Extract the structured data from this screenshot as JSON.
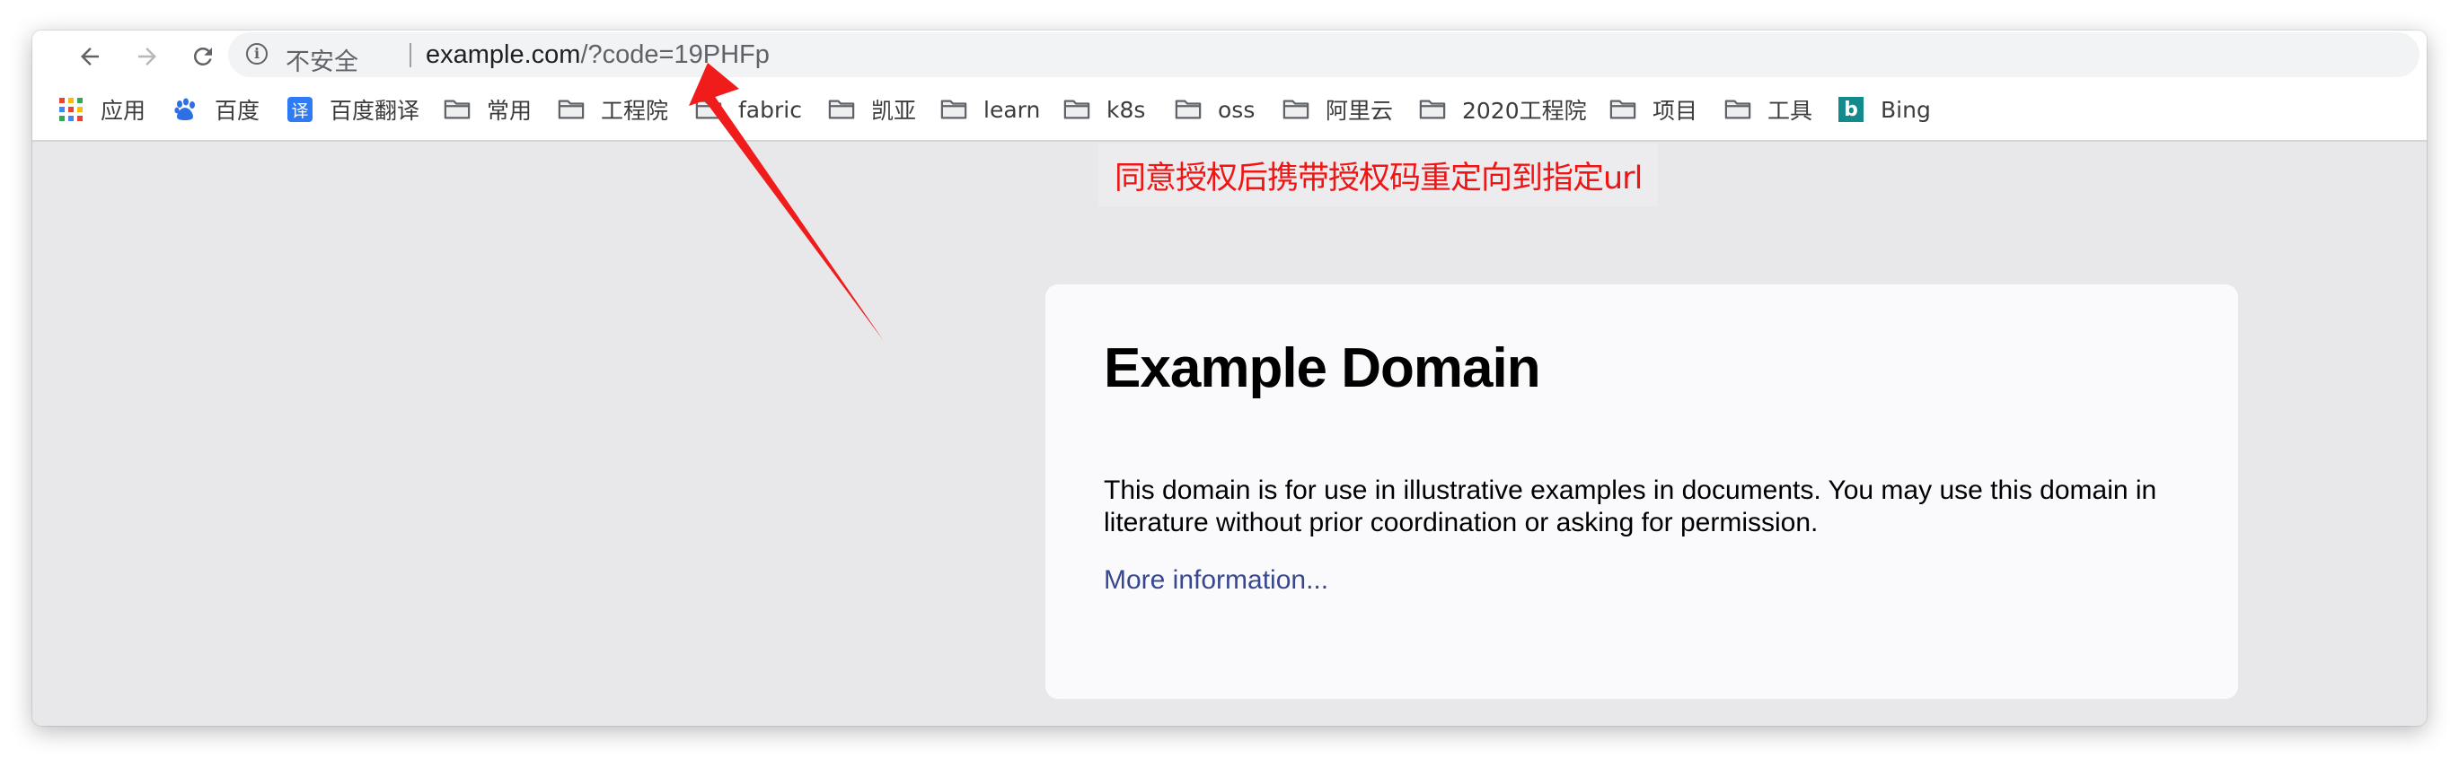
{
  "browser": {
    "nav": {
      "back_icon": "back-arrow-icon",
      "forward_icon": "forward-arrow-icon",
      "reload_icon": "reload-icon"
    },
    "omnibox": {
      "security_icon": "info-icon",
      "security_text": "不安全",
      "url_host": "example.com",
      "url_path": "/?code=19PHFp"
    },
    "bookmarks": [
      {
        "icon": "apps-grid-icon",
        "label": "应用"
      },
      {
        "icon": "baidu-paw-icon",
        "label": "百度"
      },
      {
        "icon": "baidu-translate-icon",
        "label": "百度翻译",
        "icon_text": "译"
      },
      {
        "icon": "folder-icon",
        "label": "常用"
      },
      {
        "icon": "folder-icon",
        "label": "工程院"
      },
      {
        "icon": "folder-icon",
        "label": "fabric"
      },
      {
        "icon": "folder-icon",
        "label": "凯亚"
      },
      {
        "icon": "folder-icon",
        "label": "learn"
      },
      {
        "icon": "folder-icon",
        "label": "k8s"
      },
      {
        "icon": "folder-icon",
        "label": "oss"
      },
      {
        "icon": "folder-icon",
        "label": "阿里云"
      },
      {
        "icon": "folder-icon",
        "label": "2020工程院"
      },
      {
        "icon": "folder-icon",
        "label": "项目"
      },
      {
        "icon": "folder-icon",
        "label": "工具"
      },
      {
        "icon": "bing-icon",
        "label": "Bing",
        "icon_text": "b"
      }
    ]
  },
  "annotation": {
    "text": "同意授权后携带授权码重定向到指定url",
    "color": "#f01414",
    "arrow_color": "#f01c1c"
  },
  "page": {
    "title": "Example Domain",
    "body": "This domain is for use in illustrative examples in documents. You may use this domain in literature without prior coordination or asking for permission.",
    "link": "More information..."
  }
}
